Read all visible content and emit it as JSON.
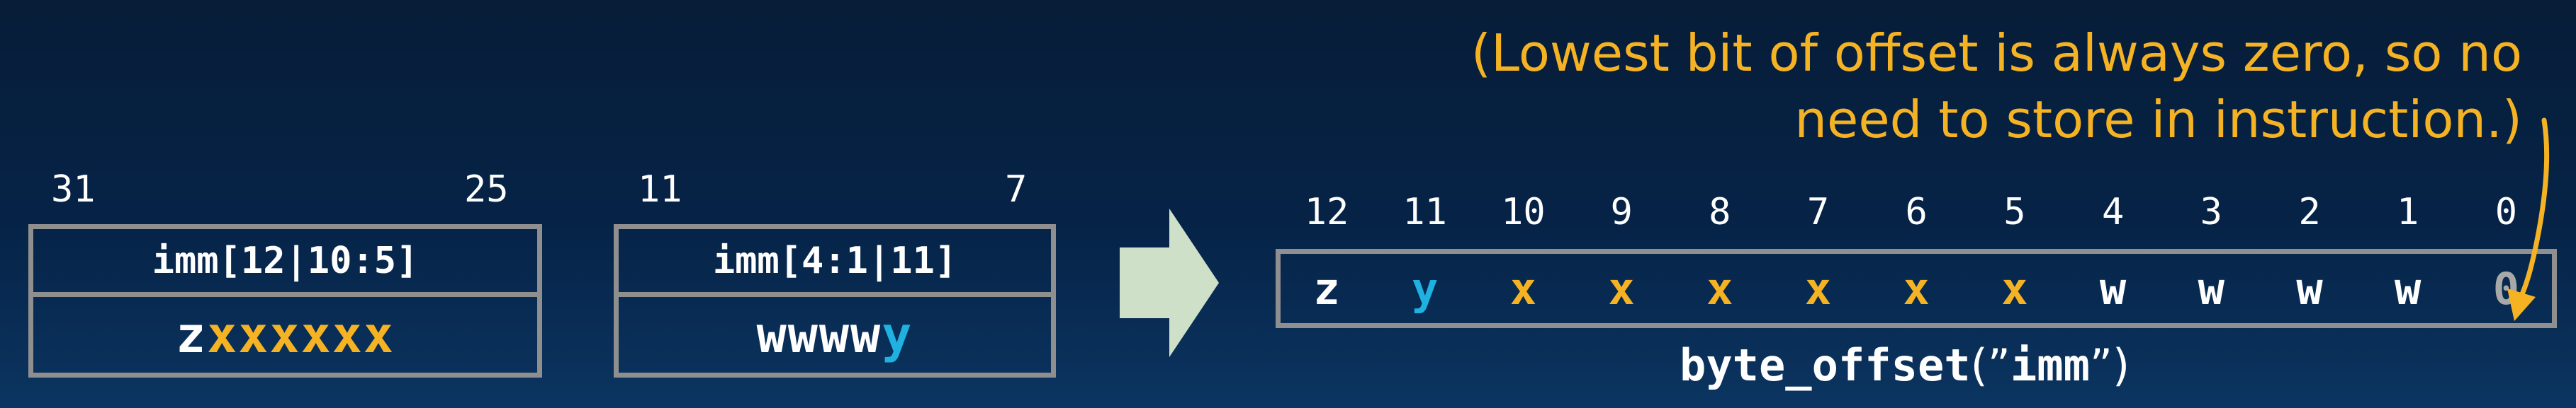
{
  "note": {
    "line1": "(Lowest bit of offset is always zero, so no",
    "line2": "need to store in instruction.)"
  },
  "fields": [
    {
      "hi": "31",
      "lo": "25",
      "header": "imm[12|10:5]",
      "bits": [
        {
          "t": "z",
          "c": "white"
        },
        {
          "t": "xxxxxx",
          "c": "yellow"
        }
      ]
    },
    {
      "hi": "11",
      "lo": "7",
      "header": "imm[4:1|11]",
      "bits": [
        {
          "t": "wwww",
          "c": "white"
        },
        {
          "t": "y",
          "c": "cyan"
        }
      ]
    }
  ],
  "offset": {
    "ticks": [
      "12",
      "11",
      "10",
      "9",
      "8",
      "7",
      "6",
      "5",
      "4",
      "3",
      "2",
      "1",
      "0"
    ],
    "bits": [
      {
        "t": "z",
        "c": "white"
      },
      {
        "t": "y",
        "c": "cyan"
      },
      {
        "t": "x",
        "c": "yellow"
      },
      {
        "t": "x",
        "c": "yellow"
      },
      {
        "t": "x",
        "c": "yellow"
      },
      {
        "t": "x",
        "c": "yellow"
      },
      {
        "t": "x",
        "c": "yellow"
      },
      {
        "t": "x",
        "c": "yellow"
      },
      {
        "t": "w",
        "c": "white"
      },
      {
        "t": "w",
        "c": "white"
      },
      {
        "t": "w",
        "c": "white"
      },
      {
        "t": "w",
        "c": "white"
      },
      {
        "t": "0",
        "c": "gray"
      }
    ],
    "caption_func": "byte_offset",
    "caption_open": "(”",
    "caption_arg": "imm",
    "caption_close": "”)"
  },
  "colors": {
    "highlight_yellow": "#f5b324",
    "highlight_cyan": "#1fb2e0",
    "arrow": "#cfe0c8"
  }
}
